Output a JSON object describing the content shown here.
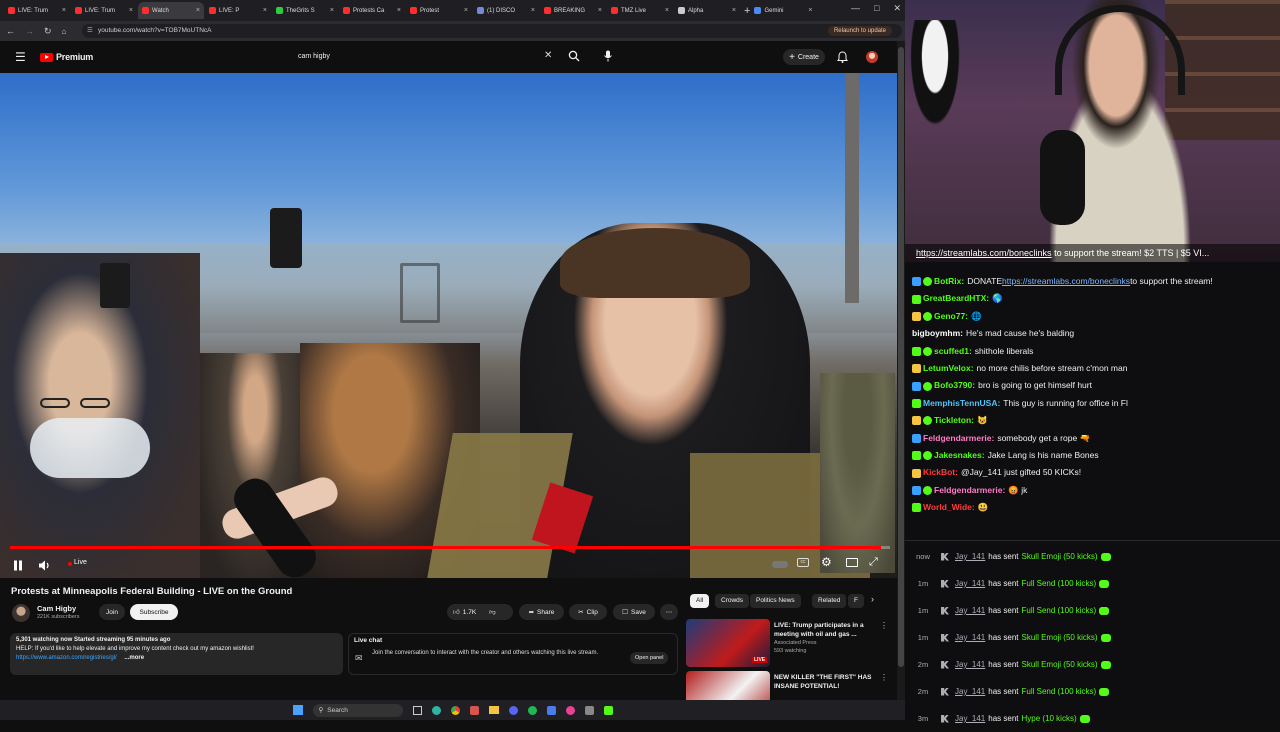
{
  "browser": {
    "tabs": [
      {
        "label": "LIVE: Trum",
        "color": "#ff2d2d"
      },
      {
        "label": "LIVE: Trum",
        "color": "#ff2d2d"
      },
      {
        "label": "Watch",
        "color": "#ff2d2d"
      },
      {
        "label": "LIVE: P",
        "color": "#ff2d2d"
      },
      {
        "label": "TheGrits S",
        "color": "#2ecc40"
      },
      {
        "label": "Protests Ca",
        "color": "#ff2d2d"
      },
      {
        "label": "Protest",
        "color": "#ff2d2d"
      },
      {
        "label": "(1) DISCO",
        "color": "#7289da"
      },
      {
        "label": "BREAKING",
        "color": "#ff2d2d"
      },
      {
        "label": "TMZ Live",
        "color": "#ff2d2d"
      },
      {
        "label": "Alpha",
        "color": "#cccccc"
      },
      {
        "label": "Gemini",
        "color": "#4c8bf5"
      }
    ],
    "url": "youtube.com/watch?v=TOB7MoUTNcA",
    "relaunch_label": "Relaunch to update"
  },
  "youtube": {
    "logo_label": "Premium",
    "search_value": "cam higby",
    "create_label": "Create",
    "live_label": "Live",
    "video_title": "Protests at Minneapolis Federal Building - LIVE on the Ground",
    "channel_name": "Cam Higby",
    "subscribers": "221K subscribers",
    "join_label": "Join",
    "subscribe_label": "Subscribe",
    "like_count": "1.7K",
    "share_label": "Share",
    "clip_label": "Clip",
    "save_label": "Save",
    "description_line1": "5,301 watching now  Started streaming 95 minutes ago",
    "description_line2": "HELP: If you'd like to help elevate and improve my content check out my amazon wishlist!",
    "description_link": "https://www.amazon.com/registries/gl/",
    "more_label": "...more",
    "live_chat_title": "Live chat",
    "live_chat_text": "Join the conversation to interact with the creator and others watching this live stream.",
    "open_panel_label": "Open panel",
    "chips": [
      "All",
      "Crowds",
      "Politics News",
      "Related",
      "F"
    ],
    "recommended": [
      {
        "title": "LIVE: Trump participates in a meeting with oil and gas ...",
        "channel": "Associated Press",
        "meta": "593 watching",
        "badge": "LIVE"
      },
      {
        "title": "NEW KILLER \"THE FIRST\" HAS INSANE POTENTIAL!",
        "channel": "",
        "meta": "",
        "badge": ""
      }
    ]
  },
  "taskbar": {
    "search_label": "Search"
  },
  "stream": {
    "banner_link": "https://streamlabs.com/boneclinks",
    "banner_text": " to support the stream! $2 TTS | $5 VI..."
  },
  "chat": [
    {
      "user": "BotRix:",
      "color": "#53fc18",
      "text": "DONATE ",
      "link": "https://streamlabs.com/boneclinks",
      "after": " to support the stream!"
    },
    {
      "user": "GreatBeardHTX:",
      "color": "#53fc18",
      "text": "🌎"
    },
    {
      "user": "Geno77:",
      "color": "#53fc18",
      "text": "🌐"
    },
    {
      "user": "bigboymhm:",
      "color": "#ffffff",
      "text": "He's mad cause he's balding"
    },
    {
      "user": "scuffed1:",
      "color": "#53fc18",
      "text": "shithole liberals"
    },
    {
      "user": "LetumVelox:",
      "color": "#53fc18",
      "text": "no more chilis before stream c'mon man"
    },
    {
      "user": "Bofo3790:",
      "color": "#53fc18",
      "text": "bro is going to get himself hurt"
    },
    {
      "user": "MemphisTennUSA:",
      "color": "#4fc3f7",
      "text": "This guy is running for office in Fl"
    },
    {
      "user": "Tickleton:",
      "color": "#53fc18",
      "text": "😺"
    },
    {
      "user": "Feldgendarmerie:",
      "color": "#ff7bc8",
      "text": "somebody get a rope 🔫"
    },
    {
      "user": "Jakesnakes:",
      "color": "#53fc18",
      "text": "Jake Lang is his name Bones"
    },
    {
      "user": "KickBot:",
      "color": "#ff3b3b",
      "text": "@Jay_141 just gifted 50 KICKs!"
    },
    {
      "user": "Feldgendarmerie:",
      "color": "#ff7bc8",
      "text": "😡 jk"
    },
    {
      "user": "World_Wide:",
      "color": "#ff3b3b",
      "text": "😃"
    }
  ],
  "events": [
    {
      "time": "now",
      "user": "Jay_141",
      "verb": "has sent",
      "gift": "Skull Emoji (50 kicks)"
    },
    {
      "time": "1m",
      "user": "Jay_141",
      "verb": "has sent",
      "gift": "Full Send (100 kicks)"
    },
    {
      "time": "1m",
      "user": "Jay_141",
      "verb": "has sent",
      "gift": "Full Send (100 kicks)"
    },
    {
      "time": "1m",
      "user": "Jay_141",
      "verb": "has sent",
      "gift": "Skull Emoji (50 kicks)"
    },
    {
      "time": "2m",
      "user": "Jay_141",
      "verb": "has sent",
      "gift": "Skull Emoji (50 kicks)"
    },
    {
      "time": "2m",
      "user": "Jay_141",
      "verb": "has sent",
      "gift": "Full Send (100 kicks)"
    },
    {
      "time": "3m",
      "user": "Jay_141",
      "verb": "has sent",
      "gift": "Hype (10 kicks)"
    }
  ],
  "colors": {
    "youtube_red": "#ff0000",
    "kick_green": "#53fc18"
  },
  "video_progress": 0.99
}
